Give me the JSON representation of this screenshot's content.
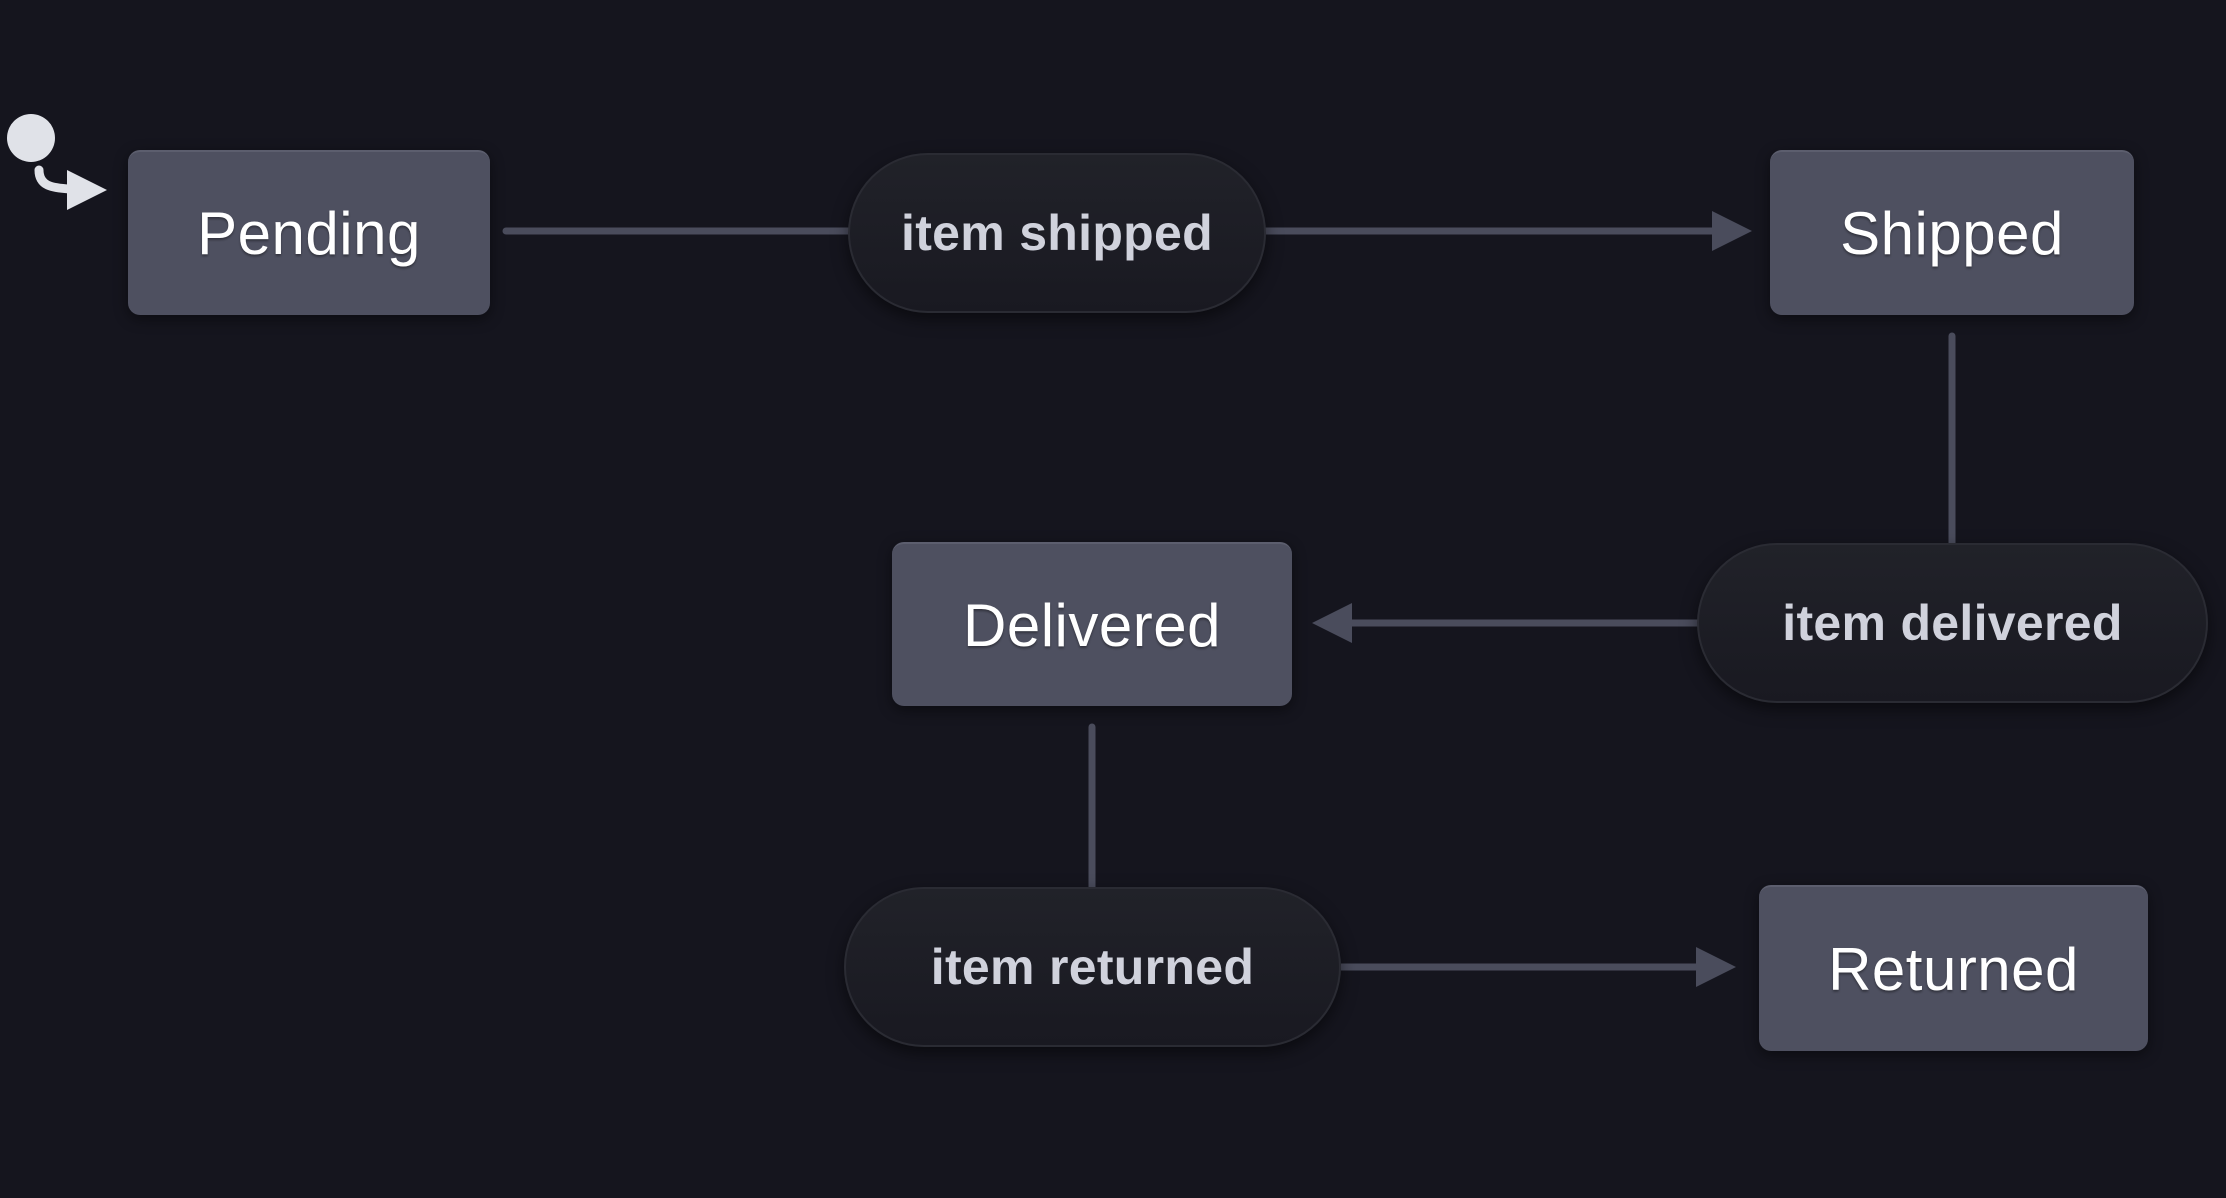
{
  "diagram": {
    "type": "state-machine",
    "initial_state": "Pending",
    "states": [
      {
        "id": "pending",
        "label": "Pending"
      },
      {
        "id": "shipped",
        "label": "Shipped"
      },
      {
        "id": "delivered",
        "label": "Delivered"
      },
      {
        "id": "returned",
        "label": "Returned"
      }
    ],
    "events": [
      {
        "id": "item_shipped",
        "label": "item shipped",
        "from": "pending",
        "to": "shipped"
      },
      {
        "id": "item_delivered",
        "label": "item delivered",
        "from": "shipped",
        "to": "delivered"
      },
      {
        "id": "item_returned",
        "label": "item returned",
        "from": "delivered",
        "to": "returned"
      }
    ]
  },
  "colors": {
    "background": "#15151e",
    "state_fill": "#4e5060",
    "state_text": "#ffffff",
    "event_fill": "#1e1f26",
    "event_text": "#d0d2dc",
    "edge": "#4a4c5c",
    "initial_marker": "#e0e2e8"
  }
}
